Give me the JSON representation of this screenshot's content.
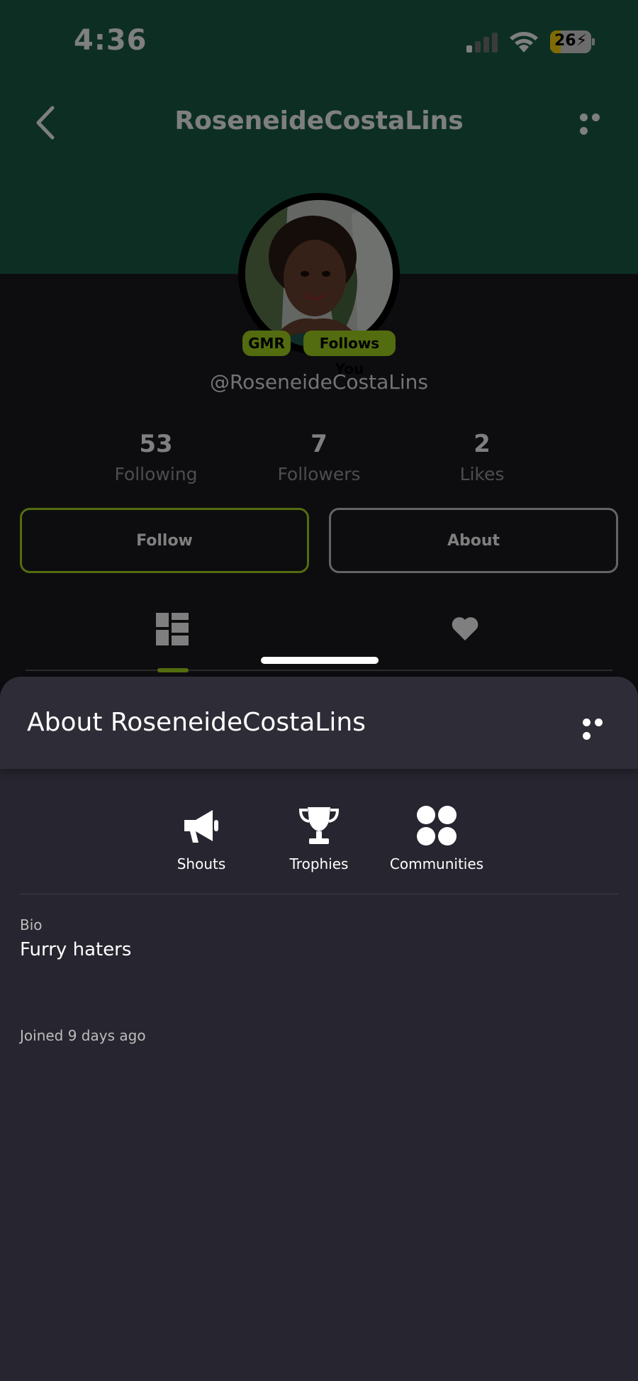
{
  "status_bar": {
    "time": "4:36",
    "battery": "26",
    "battery_level": 0.26
  },
  "nav": {
    "title": "RoseneideCostaLins"
  },
  "profile": {
    "badges": [
      "GMR",
      "Follows You"
    ],
    "handle": "@RoseneideCostaLins",
    "stats": [
      {
        "value": "53",
        "label": "Following"
      },
      {
        "value": "7",
        "label": "Followers"
      },
      {
        "value": "2",
        "label": "Likes"
      }
    ],
    "buttons": {
      "follow": "Follow",
      "about": "About"
    }
  },
  "tabs": {
    "icons": [
      "grid-icon",
      "heart-icon"
    ],
    "active": 0
  },
  "sheet": {
    "title": "About RoseneideCostaLins",
    "actions": [
      {
        "label": "Shouts",
        "icon": "megaphone-icon"
      },
      {
        "label": "Trophies",
        "icon": "trophy-icon"
      },
      {
        "label": "Communities",
        "icon": "communities-icon"
      }
    ],
    "bio_label": "Bio",
    "bio": "Furry haters",
    "joined": "Joined 9 days ago"
  },
  "colors": {
    "header": "#1a5e47",
    "accent": "#a7d91f",
    "background": "#1b1a20",
    "sheet": "#27252f"
  }
}
